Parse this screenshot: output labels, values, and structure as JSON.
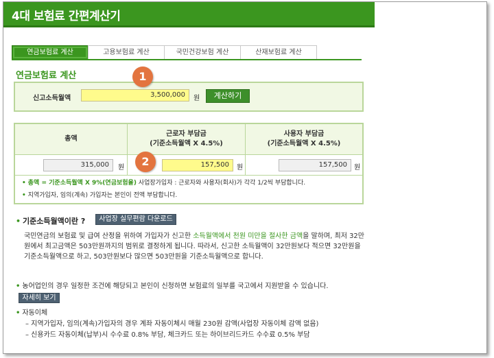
{
  "title": "4대 보험료 간편계산기",
  "tabs": [
    "연금보험료 계산",
    "고용보험료 계산",
    "국민건강보험 계산",
    "산재보험료 계산"
  ],
  "section_title": "연금보험료 계산",
  "input": {
    "label": "신고소득월액",
    "value": "3,500,000",
    "unit": "원",
    "button": "계산하기"
  },
  "badges": [
    "1",
    "2"
  ],
  "result": {
    "headers": [
      {
        "line1": "총액",
        "line2": ""
      },
      {
        "line1": "근로자 부담금",
        "line2": "(기준소득월액 X 4.5%)"
      },
      {
        "line1": "사용자 부담금",
        "line2": "(기준소득월액 X 4.5%)"
      }
    ],
    "values": [
      "315,000",
      "157,500",
      "157,500"
    ],
    "unit": "원",
    "note1_green": "총액 = 기준소득월액 X 9%(연금보험율)",
    "note1_rest": " 사업장가입자 : 근로자와 사용자(회사)가 각각 1/2씩 부담합니다.",
    "note2": "지역가입자, 임의(계속) 가입자는 본인이 전액 부담합니다."
  },
  "info": {
    "heading": "기준소득월액이란 ?",
    "download_button": "사업장 실무편람 다운로드",
    "para1_a": "국민연금의 보험료 및 급여 산정을 위하여 가입자가 신고한 ",
    "para1_hl": "소득월액에서 천원 미만을 절사한 금액",
    "para1_b": "을 말하며, 최저 32만원에서 최고금액은 503만원까지의 범위로 결정하게 됩니다. 따라서, 신고한 소득월액이 32만원보다 적으면 32만원을 기준소득월액으로 하고, 503만원보다 많으면 503만원을 기준소득월액으로 합니다.",
    "para2": "농어업인의 경우 일정한 조건에 해당되고 본인이 신청하면 보험료의 일부를 국고에서 지원받을 수 있습니다.",
    "detail_button": "자세히 보기",
    "para3_title": "자동이체",
    "para3_line1": "– 지역가입자, 임의(계속)가입자의 경우 계좌 자동이체시 매월 230원 감액(사업장 자동이체 감액 없음)",
    "para3_line2": "– 신용카드 자동이체(납부)시 수수료 0.8% 부담, 체크카드 또는 하이브리드카드 수수료 0.5% 부담"
  }
}
